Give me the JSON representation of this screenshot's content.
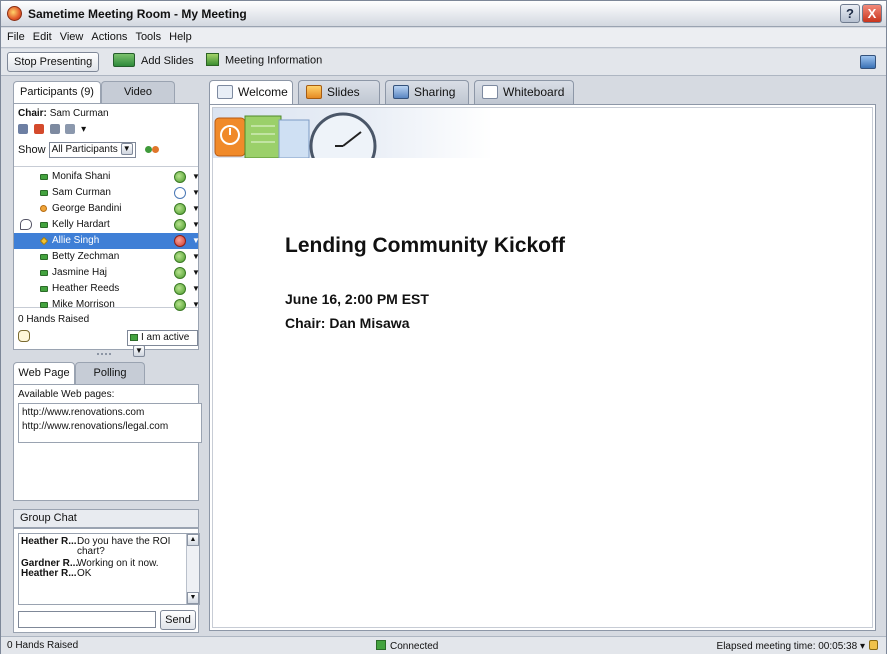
{
  "window": {
    "title": "Sametime Meeting Room - My Meeting",
    "help_glyph": "?",
    "close_glyph": "X"
  },
  "menu": [
    "File",
    "Edit",
    "View",
    "Actions",
    "Tools",
    "Help"
  ],
  "toolbar": {
    "stop_presenting": "Stop Presenting",
    "add_slides": "Add Slides",
    "meeting_information": "Meeting Information"
  },
  "left_tabs": {
    "participants": "Participants (9)",
    "video": "Video"
  },
  "participants": {
    "chair_label": "Chair:",
    "chair_name": "Sam Curman",
    "show_label": "Show",
    "show_value": "All Participants",
    "list": [
      {
        "name": "Monifa Shani",
        "status": "active"
      },
      {
        "name": "Sam Curman",
        "status": "clock"
      },
      {
        "name": "George Bandini",
        "status": "active",
        "marker": "away"
      },
      {
        "name": "Kelly Hardart",
        "status": "active",
        "speaking": true
      },
      {
        "name": "Allie Singh",
        "status": "muted",
        "selected": true,
        "marker": "diamond"
      },
      {
        "name": "Betty Zechman",
        "status": "active"
      },
      {
        "name": "Jasmine Haj",
        "status": "active"
      },
      {
        "name": "Heather Reeds",
        "status": "active"
      },
      {
        "name": "Mike Morrison",
        "status": "active"
      }
    ],
    "hands_raised": "0 Hands Raised",
    "active_status": "I am active"
  },
  "web_tabs": {
    "web_page": "Web Page",
    "polling": "Polling"
  },
  "web": {
    "label": "Available Web pages:",
    "pages": [
      "http://www.renovations.com",
      "http://www.renovations/legal.com"
    ]
  },
  "group_chat": {
    "title": "Group Chat",
    "messages": [
      {
        "who": "Heather R...",
        "text": "Do you have the ROI chart?"
      },
      {
        "who": "Gardner R...",
        "text": "Working on it now."
      },
      {
        "who": "Heather R...",
        "text": "OK"
      }
    ],
    "send": "Send"
  },
  "content_tabs": [
    "Welcome",
    "Slides",
    "Sharing",
    "Whiteboard"
  ],
  "slide": {
    "title": "Lending Community Kickoff",
    "date_line": "June 16, 2:00 PM EST",
    "chair_line": "Chair: Dan Misawa"
  },
  "status": {
    "hands": "0 Hands Raised",
    "connection": "Connected",
    "elapsed": "Elapsed meeting time: 00:05:38"
  },
  "colors": {
    "selection": "#3f7fd6",
    "status_green": "#44a33f",
    "status_red": "#d0392a"
  }
}
